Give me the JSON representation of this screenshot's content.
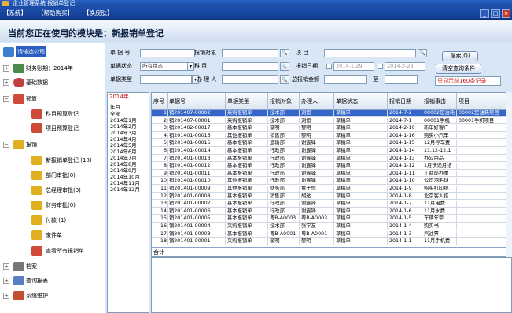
{
  "titlebar": {
    "text": "企业管理系统 报销单登记"
  },
  "menu": [
    {
      "label": "【系统】"
    },
    {
      "label": "【帮助购买】"
    },
    {
      "label": "【换皮肤】"
    }
  ],
  "header": {
    "title": "当前您正在使用的模块是：新报销单登记"
  },
  "sidebar": {
    "company": "请输选公司",
    "period": "财务账期：2014年",
    "basic": "基础数据",
    "budget": "预算",
    "budget_subject": "科目预算登记",
    "budget_project": "项目预算登记",
    "reimb": "报销",
    "reimb_new": "新报销单登记 (18)",
    "reimb_dept": "部门审批(0)",
    "reimb_boss": "总经理审批(0)",
    "reimb_fin": "财务审批(0)",
    "reimb_pay": "付款 (1)",
    "reimb_void": "废件单",
    "reimb_all": "查看所有报销单",
    "archive": "档案",
    "query": "查询报表",
    "maintain": "系统维护"
  },
  "form": {
    "doc_no_label": "单 据 号",
    "payee_label": "报销对象",
    "project_label": "项    目",
    "status_label": "单据状态",
    "status_value": "所有状态",
    "subject_label": "科    目",
    "date_label": "报销日期",
    "date_from": "2014-1-29",
    "date_to": "2014-2-28",
    "type_label": "单据类型",
    "handler_label": "办 理 人",
    "amount_label": "总报销金额",
    "to_label": "至",
    "search_btn": "搜索(Q)",
    "clear_btn": "清空查询条件",
    "recent": "只显示前160条记录"
  },
  "years": {
    "selected": "2014年",
    "items": [
      "年月",
      "全部",
      "2014年1月",
      "2014年2月",
      "2014年3月",
      "2014年4月",
      "2014年5月",
      "2014年6月",
      "2014年7月",
      "2014年8月",
      "2014年9月",
      "2014年10月",
      "2014年11月",
      "2014年12月"
    ]
  },
  "grid": {
    "headers": [
      "序号",
      "单据号",
      "单据类型",
      "报销对象",
      "办理人",
      "单据状态",
      "报销日期",
      "报销事由",
      "项目"
    ],
    "rows": [
      [
        "1",
        "销201407-00002",
        "采购报销单",
        "技术部",
        "刘恒",
        "草稿单",
        "2014-7-2",
        "00002您油耗",
        "00002您油耗项目"
      ],
      [
        "2",
        "销201407-00001",
        "采购报销单",
        "技术部",
        "刘恒",
        "草稿单",
        "2014-7-1",
        "00001手机",
        "00001手机项目"
      ],
      [
        "3",
        "销201402-00017",
        "基本报销单",
        "黎明",
        "黎明",
        "草稿单",
        "2014-2-10",
        "新年好客户",
        ""
      ],
      [
        "4",
        "销201401-00016",
        "其他报销单",
        "销售部",
        "黎明",
        "草稿单",
        "2014-1-16",
        "购买小汽车",
        ""
      ],
      [
        "5",
        "销201401-00015",
        "基本报销单",
        "运输部",
        "谢霆锋",
        "草稿单",
        "2014-1-15",
        "12月停车费",
        ""
      ],
      [
        "6",
        "销201401-00014",
        "基本报销单",
        "行政部",
        "谢霆锋",
        "草稿单",
        "2014-1-14",
        "11.12-12.1",
        ""
      ],
      [
        "7",
        "销201401-00013",
        "基本报销单",
        "行政部",
        "谢霆锋",
        "草稿单",
        "2014-1-13",
        "办公用品",
        ""
      ],
      [
        "8",
        "销201401-00012",
        "基本报销单",
        "行政部",
        "谢霆锋",
        "草稿单",
        "2014-1-12",
        "1月快递月结",
        ""
      ],
      [
        "9",
        "销201401-00011",
        "基本报销单",
        "行政部",
        "谢霆锋",
        "草稿单",
        "2014-1-11",
        "工商局办事",
        ""
      ],
      [
        "10",
        "销201401-00010",
        "其他报销单",
        "行政部",
        "谢霆锋",
        "草稿单",
        "2014-1-10",
        "公司羽毛球",
        ""
      ],
      [
        "11",
        "销201401-00009",
        "其他报销单",
        "财务部",
        "董子恒",
        "草稿单",
        "2014-1-9",
        "购买打印纸",
        ""
      ],
      [
        "12",
        "销201401-00008",
        "基本报销单",
        "销售部",
        "胡达",
        "草稿单",
        "2014-1-8",
        "北京客人招",
        ""
      ],
      [
        "13",
        "销201401-00007",
        "基本报销单",
        "行政部",
        "谢霆锋",
        "草稿单",
        "2014-1-7",
        "11月电费",
        ""
      ],
      [
        "14",
        "销201401-00006",
        "基本报销单",
        "行政部",
        "谢霆锋",
        "草稿单",
        "2014-1-6",
        "11月水费",
        ""
      ],
      [
        "15",
        "销201401-00005",
        "基本报销单",
        "粤B-A0003",
        "粤B-A0003",
        "草稿单",
        "2014-1-5",
        "车辆年审",
        ""
      ],
      [
        "16",
        "销201401-00004",
        "采购报销单",
        "技术部",
        "张学友",
        "草稿单",
        "2014-1-4",
        "购买书",
        ""
      ],
      [
        "17",
        "销201401-00003",
        "基本报销单",
        "粤B-A0001",
        "粤B-A0001",
        "草稿单",
        "2014-1-3",
        "汽油票",
        ""
      ],
      [
        "18",
        "销201401-00001",
        "采购报销单",
        "黎明",
        "黎明",
        "草稿单",
        "2014-1-1",
        "11月手机费",
        ""
      ]
    ],
    "total_label": "合计"
  }
}
